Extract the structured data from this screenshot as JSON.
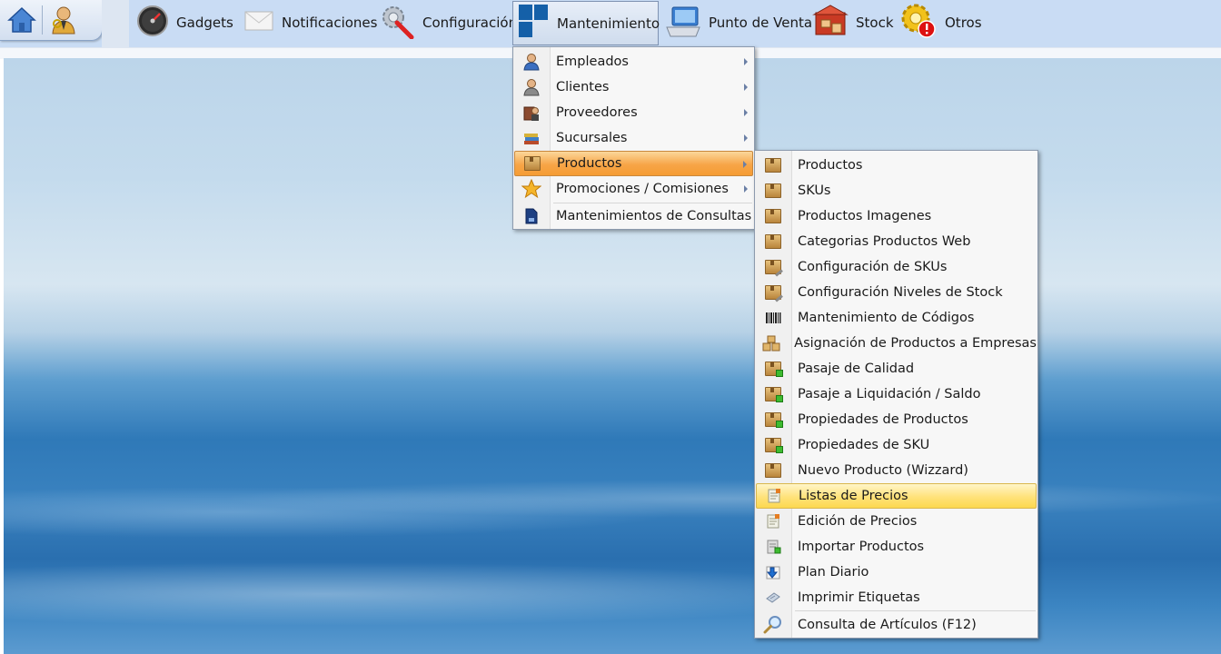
{
  "toolbar": {
    "items": [
      {
        "label": "Gadgets",
        "icon": "gauge-icon"
      },
      {
        "label": "Notificaciones",
        "icon": "envelope-icon"
      },
      {
        "label": "Configuración",
        "icon": "wrench-gear-icon"
      },
      {
        "label": "Mantenimiento",
        "icon": "windows-tiles-icon"
      },
      {
        "label": "Punto de Venta",
        "icon": "pos-terminal-icon"
      },
      {
        "label": "Stock",
        "icon": "warehouse-icon"
      },
      {
        "label": "Otros",
        "icon": "gear-alert-icon"
      }
    ],
    "active": "Mantenimiento"
  },
  "mantenimiento_menu": {
    "items": [
      {
        "label": "Empleados",
        "icon": "employee-icon",
        "submenu": true
      },
      {
        "label": "Clientes",
        "icon": "client-icon",
        "submenu": true
      },
      {
        "label": "Proveedores",
        "icon": "supplier-icon",
        "submenu": true
      },
      {
        "label": "Sucursales",
        "icon": "books-icon",
        "submenu": true
      },
      {
        "label": "Productos",
        "icon": "box-icon",
        "submenu": true,
        "highlighted": true
      },
      {
        "label": "Promociones / Comisiones",
        "icon": "star-icon",
        "submenu": true
      },
      {
        "label": "Mantenimientos de Consultas",
        "icon": "document-icon",
        "submenu": false
      }
    ]
  },
  "productos_submenu": {
    "items": [
      {
        "label": "Productos",
        "icon": "box-icon"
      },
      {
        "label": "SKUs",
        "icon": "box-icon"
      },
      {
        "label": "Productos Imagenes",
        "icon": "box-icon"
      },
      {
        "label": "Categorias Productos Web",
        "icon": "box-icon"
      },
      {
        "label": "Configuración de SKUs",
        "icon": "box-tool-icon"
      },
      {
        "label": "Configuración Niveles de Stock",
        "icon": "box-tool-icon"
      },
      {
        "label": "Mantenimiento de Códigos",
        "icon": "barcode-icon"
      },
      {
        "label": "Asignación de Productos a Empresas",
        "icon": "stacked-boxes-icon"
      },
      {
        "label": "Pasaje de Calidad",
        "icon": "box-green-icon"
      },
      {
        "label": "Pasaje a Liquidación / Saldo",
        "icon": "box-green-icon"
      },
      {
        "label": "Propiedades de Productos",
        "icon": "box-green-icon"
      },
      {
        "label": "Propiedades de SKU",
        "icon": "box-green-icon"
      },
      {
        "label": "Nuevo Producto (Wizzard)",
        "icon": "box-icon"
      },
      {
        "label": "Listas de Precios",
        "icon": "price-list-icon",
        "highlighted": true
      },
      {
        "label": "Edición de Precios",
        "icon": "price-list-icon"
      },
      {
        "label": "Importar Productos",
        "icon": "import-icon"
      },
      {
        "label": "Plan Diario",
        "icon": "download-arrow-icon"
      },
      {
        "label": "Imprimir Etiquetas",
        "icon": "label-icon"
      },
      {
        "label": "Consulta de Artículos (F12)",
        "icon": "magnifier-icon"
      }
    ]
  }
}
